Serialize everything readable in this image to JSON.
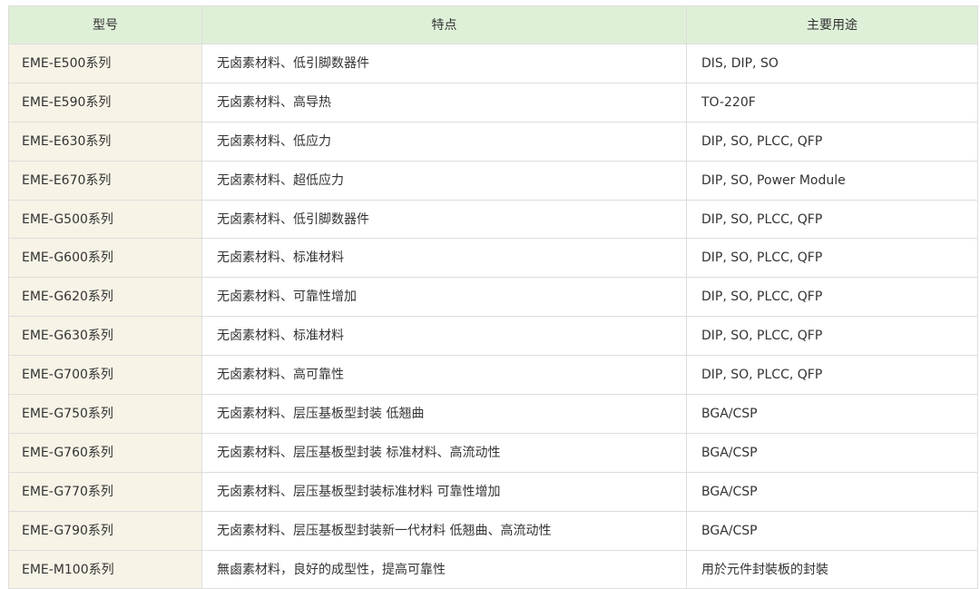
{
  "table": {
    "headers": [
      "型号",
      "特点",
      "主要用途"
    ],
    "rows": [
      [
        "EME-E500系列",
        "无卤素材料、低引脚数器件",
        "DIS, DIP, SO"
      ],
      [
        "EME-E590系列",
        "无卤素材料、高导热",
        "TO-220F"
      ],
      [
        "EME-E630系列",
        "无卤素材料、低应力",
        "DIP, SO, PLCC, QFP"
      ],
      [
        "EME-E670系列",
        "无卤素材料、超低应力",
        "DIP, SO, Power Module"
      ],
      [
        "EME-G500系列",
        "无卤素材料、低引脚数器件",
        "DIP, SO, PLCC, QFP"
      ],
      [
        "EME-G600系列",
        "无卤素材料、标准材料",
        "DIP, SO, PLCC, QFP"
      ],
      [
        "EME-G620系列",
        "无卤素材料、可靠性增加",
        "DIP, SO, PLCC, QFP"
      ],
      [
        "EME-G630系列",
        "无卤素材料、标准材料",
        "DIP, SO, PLCC, QFP"
      ],
      [
        "EME-G700系列",
        "无卤素材料、高可靠性",
        "DIP, SO, PLCC, QFP"
      ],
      [
        "EME-G750系列",
        "无卤素材料、层压基板型封装 低翘曲",
        "BGA/CSP"
      ],
      [
        "EME-G760系列",
        "无卤素材料、层压基板型封装 标准材料、高流动性",
        "BGA/CSP"
      ],
      [
        "EME-G770系列",
        "无卤素材料、层压基板型封装标准材料 可靠性增加",
        "BGA/CSP"
      ],
      [
        "EME-G790系列",
        "无卤素材料、层压基板型封装新一代材料 低翘曲、高流动性",
        "BGA/CSP"
      ],
      [
        "EME-M100系列",
        "無鹵素材料，良好的成型性，提高可靠性",
        "用於元件封裝板的封裝"
      ]
    ]
  }
}
